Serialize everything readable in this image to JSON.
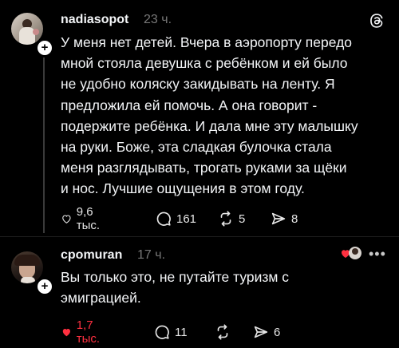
{
  "posts": [
    {
      "username": "nadiasopot",
      "time": "23 ч.",
      "text": "У меня нет детей. Вчера в аэропорту передо\nмной стояла девушка с ребёнком и ей было\nне удобно коляску закидывать на ленту. Я\nпредложила ей помочь. А она говорит -\nподержите ребёнка. И дала мне эту малышку\nна руки. Боже, эта сладкая булочка стала\nменя разглядывать, трогать руками за щёки\nи нос. Лучшие ощущения в этом году.",
      "likes": "9,6 тыс.",
      "comments": "161",
      "reposts": "5",
      "shares": "8",
      "liked": false
    },
    {
      "username": "cpomuran",
      "time": "17 ч.",
      "text": "Вы только это, не путайте туризм с\nэмиграцией.",
      "likes": "1,7 тыс.",
      "comments": "11",
      "reposts": "",
      "shares": "6",
      "liked": true
    }
  ],
  "colors": {
    "like_active": "#ff3040",
    "muted": "#777777"
  },
  "icons": [
    "threads-logo-icon",
    "heart-icon",
    "comment-icon",
    "repost-icon",
    "share-icon",
    "follow-plus-icon",
    "more-icon"
  ]
}
